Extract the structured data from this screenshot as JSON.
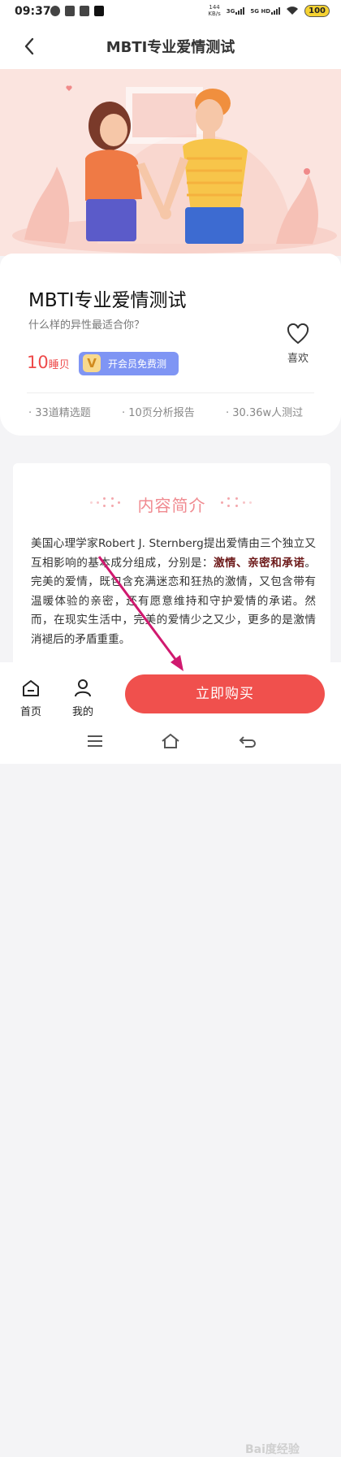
{
  "status_bar": {
    "time": "09:37",
    "net_speed_value": "144",
    "net_speed_unit": "KB/s",
    "signal_1": "3G",
    "signal_2": "5G HD",
    "battery": "100",
    "icons": [
      "gear-icon",
      "flag-icon",
      "clipboard-icon",
      "tiktok-icon",
      "wifi-icon"
    ]
  },
  "header": {
    "title": "MBTI专业爱情测试",
    "back_icon": "chevron-left-icon"
  },
  "test": {
    "title": "MBTI专业爱情测试",
    "subtitle": "什么样的异性最适合你？",
    "price_value": "10",
    "price_unit": "睡贝",
    "vip_badge": "V",
    "vip_label": "开会员免费测",
    "like_label": "喜欢",
    "stats": [
      "33道精选题",
      "10页分析报告",
      "30.36w人测过"
    ]
  },
  "intro": {
    "section_title": "内容简介",
    "text_1": "美国心理学家Robert J. Sternberg提出爱情由三个独立又互相影响的基本成分组成，分别是：",
    "text_bold": "激情、亲密和承诺",
    "text_2": "。完美的爱情，既包含充满迷恋和狂热的激情，又包含带有温暖体验的亲密，还有愿意维持和守护爱情的承诺。然而，在现实生活中，完美的爱情少之又少，更多的是激情消褪后的矛盾重重。"
  },
  "bottom_bar": {
    "home_label": "首页",
    "mine_label": "我的",
    "buy_label": "立即购买"
  },
  "watermark": "Bai度经验",
  "colors": {
    "accent": "#f0504d",
    "price": "#ee4a4a",
    "vip": "#7f95f4",
    "hero_bg": "#fbe4df",
    "section_title": "#f08a90",
    "arrow": "#d0196f"
  }
}
